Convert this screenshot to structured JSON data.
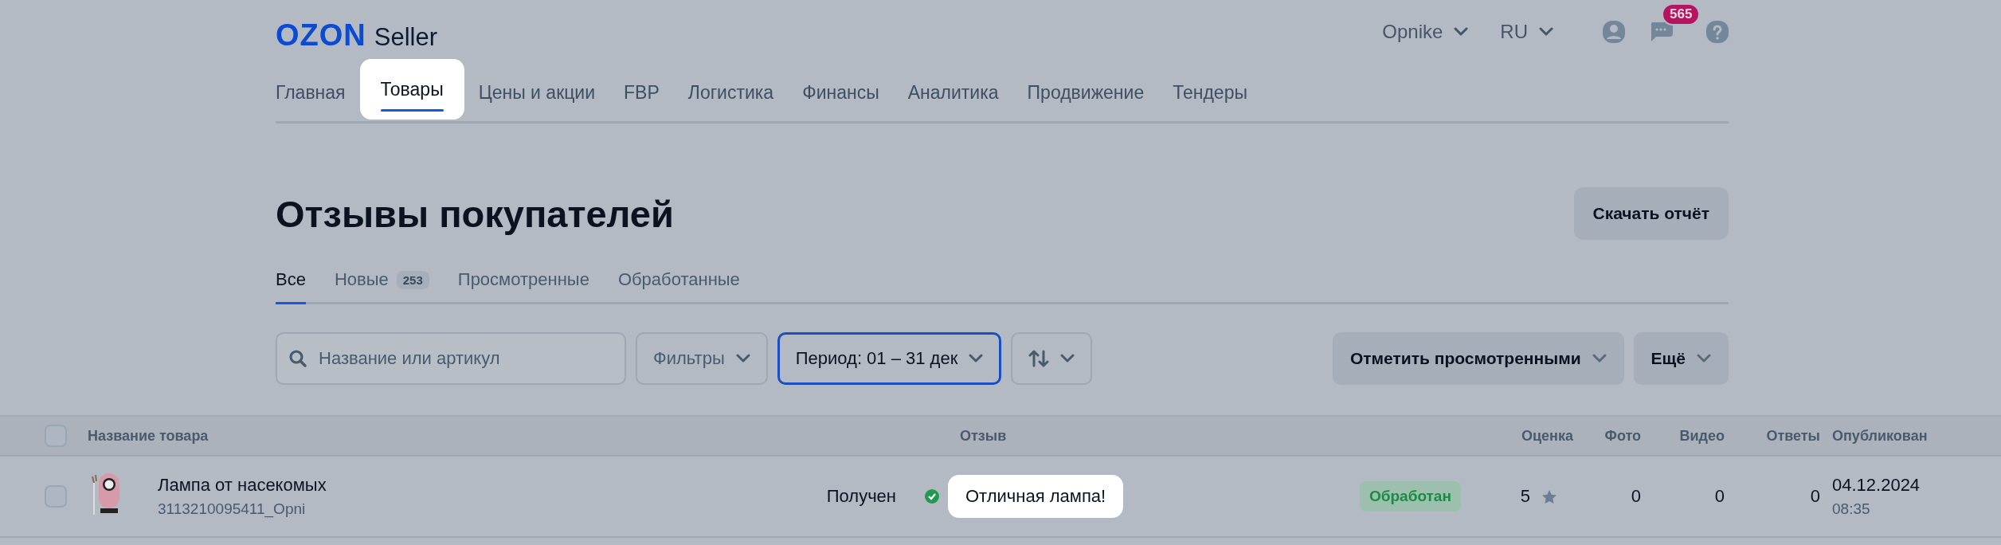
{
  "header": {
    "logo": "OZON",
    "logo_suffix": "Seller",
    "account": "Opnike",
    "language": "RU",
    "notifications": "565"
  },
  "nav": [
    {
      "label": "Главная",
      "selected": false
    },
    {
      "label": "Товары",
      "selected": true
    },
    {
      "label": "Цены и акции",
      "selected": false
    },
    {
      "label": "FBP",
      "selected": false
    },
    {
      "label": "Логистика",
      "selected": false
    },
    {
      "label": "Финансы",
      "selected": false
    },
    {
      "label": "Аналитика",
      "selected": false
    },
    {
      "label": "Продвижение",
      "selected": false
    },
    {
      "label": "Тендеры",
      "selected": false
    }
  ],
  "page": {
    "title": "Отзывы покупателей",
    "download_button": "Скачать отчёт"
  },
  "tabs": [
    {
      "label": "Все",
      "selected": true
    },
    {
      "label": "Новые",
      "count": "253",
      "selected": false
    },
    {
      "label": "Просмотренные",
      "selected": false
    },
    {
      "label": "Обработанные",
      "selected": false
    }
  ],
  "toolbar": {
    "search": {
      "placeholder": "Название или артикул"
    },
    "filters": "Фильтры",
    "period": {
      "label": "Период: 01 – 31 дек",
      "active": true
    },
    "mark_viewed": "Отметить просмотренными",
    "more": "Ещё"
  },
  "table": {
    "select_all_checked": false,
    "columns": [
      "Название товара",
      "Отзыв",
      "Оценка",
      "Фото",
      "Видео",
      "Ответы",
      "Опубликован"
    ],
    "rows": [
      {
        "checked": false,
        "product": "Лампа от насекомых",
        "sku": "3113210095411_Opni",
        "review_state": "Получен",
        "review": "Отличная лампа!",
        "status": "Обработан",
        "rating": "5",
        "photos": "0",
        "videos": "0",
        "answers": "0",
        "date": "04.12.2024",
        "time": "08:35"
      }
    ]
  }
}
